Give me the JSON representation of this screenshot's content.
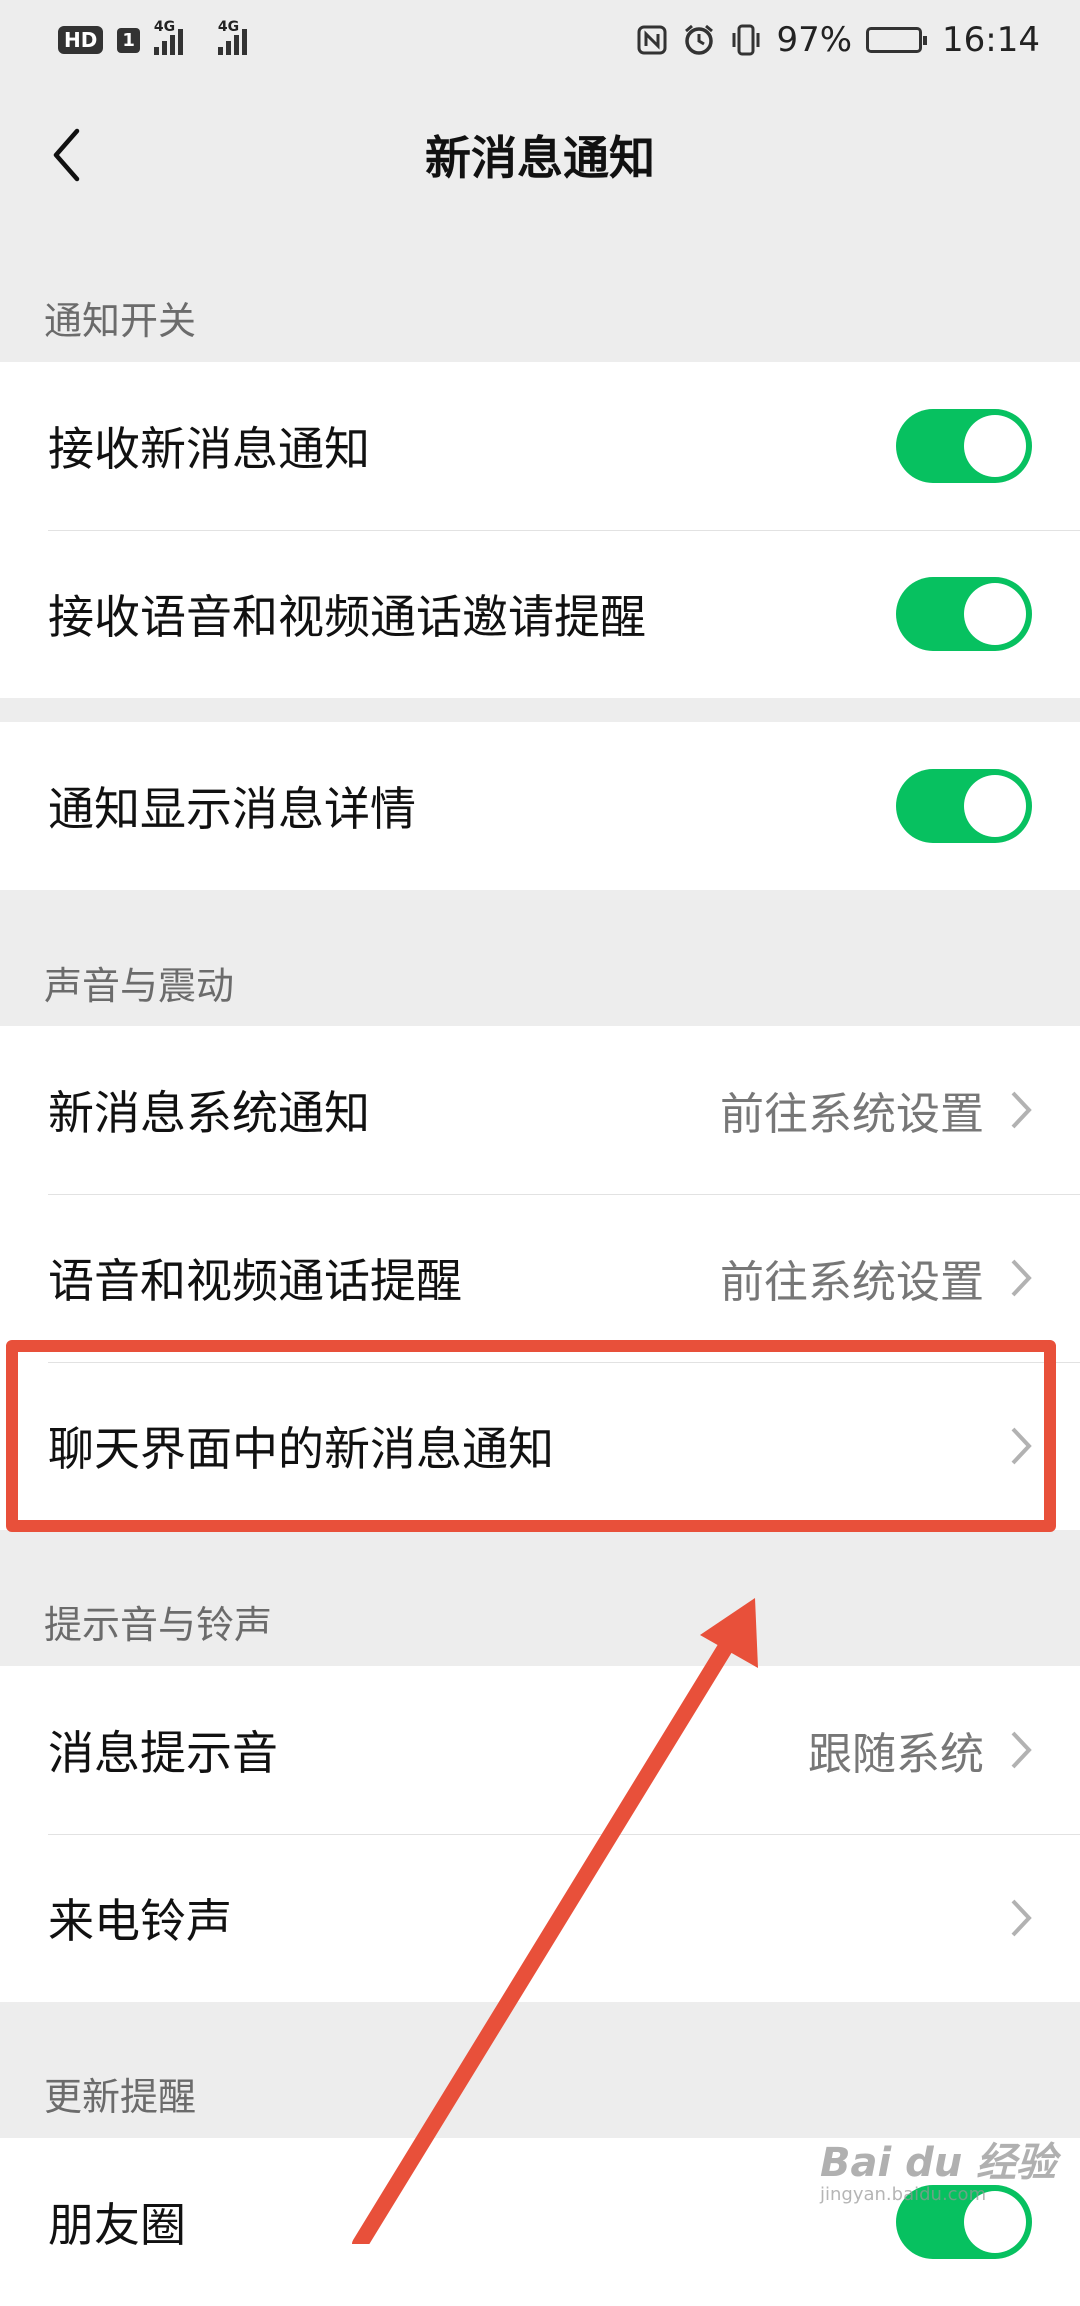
{
  "status_bar": {
    "hd": "HD",
    "sim": "1",
    "net1": "4G",
    "net2": "4G",
    "battery": "97%",
    "time": "16:14"
  },
  "nav": {
    "title": "新消息通知"
  },
  "sections": {
    "notify_switch": "通知开关",
    "sound_vibration": "声音与震动",
    "tone_ringtone": "提示音与铃声",
    "update_reminder": "更新提醒"
  },
  "rows": {
    "receive_new": {
      "label": "接收新消息通知",
      "on": true
    },
    "receive_call": {
      "label": "接收语音和视频通话邀请提醒",
      "on": true
    },
    "show_detail": {
      "label": "通知显示消息详情",
      "on": true
    },
    "system_notify": {
      "label": "新消息系统通知",
      "value": "前往系统设置"
    },
    "call_remind": {
      "label": "语音和视频通话提醒",
      "value": "前往系统设置"
    },
    "chat_notify": {
      "label": "聊天界面中的新消息通知"
    },
    "msg_tone": {
      "label": "消息提示音",
      "value": "跟随系统"
    },
    "ringtone": {
      "label": "来电铃声"
    },
    "moments": {
      "label": "朋友圈",
      "on": true
    }
  },
  "watermark": {
    "main": "Bai du 经验",
    "sub": "jingyan.baidu.com"
  },
  "colors": {
    "accent": "#07c160",
    "annotation": "#e8503a",
    "background": "#ededed"
  }
}
